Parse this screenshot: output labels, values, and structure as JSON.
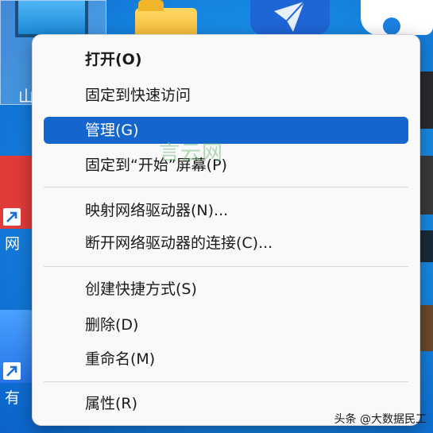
{
  "desktop": {
    "left_labels": [
      "山",
      "网",
      "有"
    ]
  },
  "context_menu": {
    "items": [
      {
        "label": "打开(O)",
        "bold": true
      },
      {
        "label": "固定到快速访问"
      },
      {
        "label": "管理(G)",
        "highlighted": true
      },
      {
        "label": "固定到“开始”屏幕(P)"
      },
      {
        "label": "映射网络驱动器(N)..."
      },
      {
        "label": "断开网络驱动器的连接(C)..."
      },
      {
        "label": "创建快捷方式(S)"
      },
      {
        "label": "删除(D)"
      },
      {
        "label": "重命名(M)"
      },
      {
        "label": "属性(R)"
      }
    ]
  },
  "watermarks": {
    "middle": "言云网",
    "corner": "头条 @大数据民工"
  },
  "colors": {
    "highlight": "#1565cf",
    "menu_background": "#f9f9f9",
    "desktop": "#1f8fe6"
  }
}
